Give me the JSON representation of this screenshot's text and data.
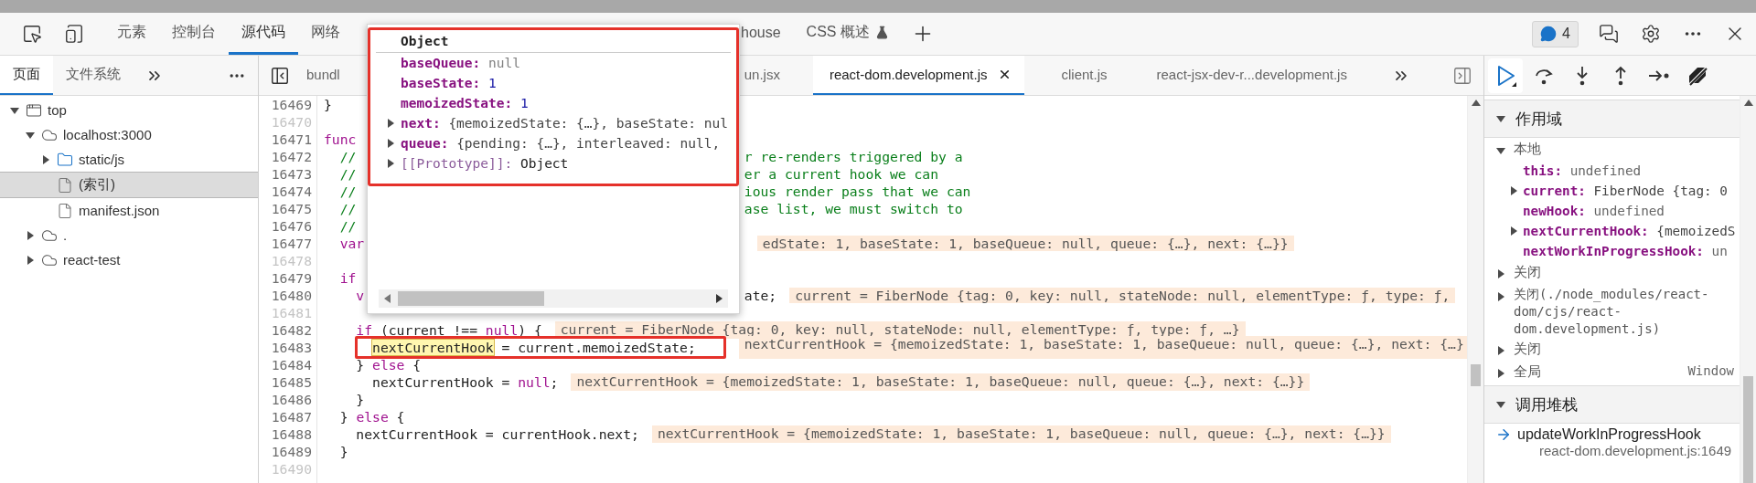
{
  "toolbar": {
    "tabs": [
      {
        "label": "元素",
        "selected": false
      },
      {
        "label": "控制台",
        "selected": false
      },
      {
        "label": "源代码",
        "selected": true
      },
      {
        "label": "网络",
        "selected": false
      }
    ],
    "tabs_after_popup": [
      {
        "label": "house",
        "kind": "plain",
        "selected": false
      },
      {
        "label": "CSS 概述",
        "kind": "experimental",
        "selected": false
      }
    ],
    "issues_count": "4"
  },
  "navigator": {
    "tabs": [
      {
        "label": "页面",
        "selected": true
      },
      {
        "label": "文件系统",
        "selected": false
      }
    ],
    "tree": [
      {
        "label": "top",
        "kind": "frame",
        "expanded": true,
        "selected": false,
        "children": [
          {
            "label": "localhost:3000",
            "kind": "domain",
            "expanded": true,
            "selected": false,
            "children": [
              {
                "label": "static/js",
                "kind": "folder",
                "expanded": false,
                "selected": false
              },
              {
                "label": "(索引)",
                "kind": "file",
                "selected": true
              },
              {
                "label": "manifest.json",
                "kind": "file",
                "selected": false
              }
            ]
          },
          {
            "label": ".",
            "kind": "domain",
            "expanded": false,
            "selected": false
          },
          {
            "label": "react-test",
            "kind": "domain",
            "expanded": false,
            "selected": false
          }
        ]
      }
    ]
  },
  "editor": {
    "tabs_before_popup": [
      {
        "label": "bundl",
        "selected": false
      }
    ],
    "tabs": [
      {
        "label": "un.jsx",
        "selected": false
      },
      {
        "label": "react-dom.development.js",
        "selected": true
      },
      {
        "label": "client.js",
        "selected": false
      },
      {
        "label": "react-jsx-dev-r...development.js",
        "selected": false
      }
    ],
    "lines": [
      {
        "number": "16469",
        "muted": false,
        "before": [
          {
            "text": "}",
            "kind": "plain"
          }
        ]
      },
      {
        "number": "16470",
        "muted": true
      },
      {
        "number": "16471",
        "muted": false,
        "before": [
          {
            "text": "func",
            "kind": "keyword"
          }
        ]
      },
      {
        "number": "16472",
        "muted": false,
        "before": [
          {
            "text": "  //",
            "kind": "comment"
          }
        ],
        "after": [
          {
            "text": "r re-renders triggered by a",
            "kind": "comment"
          }
        ]
      },
      {
        "number": "16473",
        "muted": false,
        "before": [
          {
            "text": "  //",
            "kind": "comment"
          }
        ],
        "after": [
          {
            "text": "er a current hook we can",
            "kind": "comment"
          }
        ]
      },
      {
        "number": "16474",
        "muted": false,
        "before": [
          {
            "text": "  //",
            "kind": "comment"
          }
        ],
        "after": [
          {
            "text": "ious render pass that we can",
            "kind": "comment"
          }
        ]
      },
      {
        "number": "16475",
        "muted": false,
        "before": [
          {
            "text": "  //",
            "kind": "comment"
          }
        ],
        "after": [
          {
            "text": "ase list, we must switch to",
            "kind": "comment"
          }
        ]
      },
      {
        "number": "16476",
        "muted": false,
        "before": [
          {
            "text": "  //",
            "kind": "comment"
          }
        ]
      },
      {
        "number": "16477",
        "muted": false,
        "before": [
          {
            "text": "  var",
            "kind": "keyword"
          }
        ],
        "after": [
          {
            "text": "edState: 1, baseState: 1, baseQueue: null, queue: {…}, next: {…}}",
            "kind": "value"
          }
        ]
      },
      {
        "number": "16478",
        "muted": true
      },
      {
        "number": "16479",
        "muted": false,
        "before": [
          {
            "text": "  if",
            "kind": "keyword"
          }
        ]
      },
      {
        "number": "16480",
        "muted": false,
        "before": [
          {
            "text": "    v",
            "kind": "keyword"
          }
        ],
        "after": [
          {
            "text": "ate;",
            "kind": "plain"
          },
          {
            "text": "current = FiberNode {tag: 0, key: null, stateNode: null, elementType: ƒ, type: ƒ,",
            "kind": "value"
          }
        ]
      },
      {
        "number": "16481",
        "muted": true
      },
      {
        "number": "16482",
        "muted": false,
        "before": [
          {
            "text": "    if",
            "kind": "keyword"
          },
          {
            "text": " (current !== ",
            "kind": "plain"
          },
          {
            "text": "null",
            "kind": "keyword"
          },
          {
            "text": ") {",
            "kind": "plain"
          },
          {
            "text": "current = FiberNode {tag: 0, key: null, stateNode: null, elementType: ƒ, type: ƒ, …}",
            "kind": "value"
          }
        ]
      },
      {
        "number": "16483",
        "muted": false,
        "annotated": true,
        "before": [
          {
            "text": "      nextCurrentHook",
            "kind": "match"
          },
          {
            "text": " = current.memoizedState;",
            "kind": "plain"
          },
          {
            "text": "nextCurrentHook = {memoizedState: 1, baseState: 1, baseQueue: null, queue: {…}, next: {…}",
            "kind": "value"
          }
        ]
      },
      {
        "number": "16484",
        "muted": false,
        "before": [
          {
            "text": "    } ",
            "kind": "plain"
          },
          {
            "text": "else",
            "kind": "keyword"
          },
          {
            "text": " {",
            "kind": "plain"
          }
        ]
      },
      {
        "number": "16485",
        "muted": false,
        "before": [
          {
            "text": "      nextCurrentHook = ",
            "kind": "plain"
          },
          {
            "text": "null",
            "kind": "keyword"
          },
          {
            "text": ";",
            "kind": "plain"
          },
          {
            "text": "nextCurrentHook = {memoizedState: 1, baseState: 1, baseQueue: null, queue: {…}, next: {…}}",
            "kind": "value"
          }
        ]
      },
      {
        "number": "16486",
        "muted": false,
        "before": [
          {
            "text": "    }",
            "kind": "plain"
          }
        ]
      },
      {
        "number": "16487",
        "muted": false,
        "before": [
          {
            "text": "  } ",
            "kind": "plain"
          },
          {
            "text": "else",
            "kind": "keyword"
          },
          {
            "text": " {",
            "kind": "plain"
          }
        ]
      },
      {
        "number": "16488",
        "muted": false,
        "before": [
          {
            "text": "    nextCurrentHook = currentHook.next;",
            "kind": "plain"
          },
          {
            "text": "nextCurrentHook = {memoizedState: 1, baseState: 1, baseQueue: null, queue: {…}, next: {…}}",
            "kind": "value"
          }
        ]
      },
      {
        "number": "16489",
        "muted": false,
        "before": [
          {
            "text": "  }",
            "kind": "plain"
          }
        ]
      },
      {
        "number": "16490",
        "muted": true
      }
    ]
  },
  "popup": {
    "title": "Object",
    "properties": [
      {
        "name": "baseQueue:",
        "value": "null",
        "kind": "null"
      },
      {
        "name": "baseState:",
        "value": "1",
        "kind": "number"
      },
      {
        "name": "memoizedState:",
        "value": "1",
        "kind": "number"
      },
      {
        "name": "next:",
        "value": "{memoizedState: {…}, baseState: nul",
        "kind": "object",
        "expanded": false
      },
      {
        "name": "queue:",
        "value": "{pending: {…}, interleaved: null,",
        "kind": "object",
        "expanded": false
      },
      {
        "name": "[[Prototype]]:",
        "value": "Object",
        "kind": "internal",
        "expanded": false
      }
    ]
  },
  "debugger": {
    "scope": {
      "title": "作用域",
      "expanded": true,
      "groups": [
        {
          "label": "本地",
          "expanded": true,
          "properties": [
            {
              "name": "this:",
              "value": "undefined",
              "kind": "leaf"
            },
            {
              "name": "current:",
              "value": "FiberNode {tag: 0",
              "kind": "object",
              "expanded": false
            },
            {
              "name": "newHook:",
              "value": "undefined",
              "kind": "leaf"
            },
            {
              "name": "nextCurrentHook:",
              "value": "{memoizedS",
              "kind": "object",
              "expanded": false
            },
            {
              "name": "nextWorkInProgressHook:",
              "value": "un",
              "kind": "leaf"
            }
          ]
        },
        {
          "label": "关闭",
          "expanded": false
        },
        {
          "label": "关闭(./node_modules/react-dom/cjs/react-dom.development.js)",
          "expanded": false
        },
        {
          "label": "关闭",
          "expanded": false
        },
        {
          "label": "全局",
          "expanded": false,
          "value": "Window"
        }
      ]
    },
    "call_stack": {
      "title": "调用堆栈",
      "expanded": true,
      "frames": [
        {
          "function": "updateWorkInProgressHook",
          "location": "react-dom.development.js:1649",
          "current": true
        }
      ]
    }
  }
}
